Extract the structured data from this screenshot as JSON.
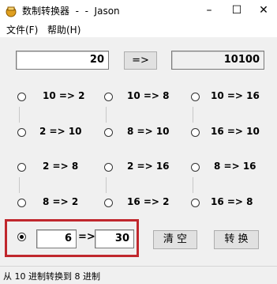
{
  "window": {
    "title": "数制转换器  -  -  Jason",
    "minimize": "–",
    "maximize": "☐",
    "close": "✕"
  },
  "menu": {
    "file": "文件(F)",
    "help": "帮助(H)"
  },
  "top": {
    "input": "20",
    "convert_button": "=>",
    "output": "10100"
  },
  "options": [
    {
      "label": "10 => 2"
    },
    {
      "label": "10 => 8"
    },
    {
      "label": "10 => 16"
    },
    {
      "label": "2 => 10"
    },
    {
      "label": "8 => 10"
    },
    {
      "label": "16 => 10"
    },
    {
      "label": "2 => 8"
    },
    {
      "label": "2 => 16"
    },
    {
      "label": "8 => 16"
    },
    {
      "label": "8 => 2"
    },
    {
      "label": "16 => 2"
    },
    {
      "label": "16 => 8"
    }
  ],
  "custom": {
    "from_base": "6",
    "arrow": "=>",
    "to_base": "30",
    "clear_button": "清 空",
    "convert_button": "转 换"
  },
  "status": {
    "text": "从 10 进制转换到 8 进制"
  },
  "colors": {
    "highlight": "#c0272d",
    "background": "#f0f0f0"
  }
}
